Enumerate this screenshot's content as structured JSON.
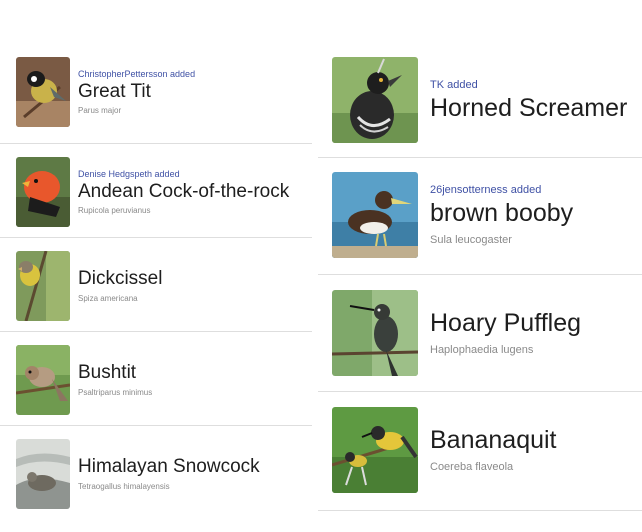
{
  "left_column": [
    {
      "added_by": "ChristopherPettersson added",
      "common_name": "Great Tit",
      "scientific_name": "Parus major",
      "thumb_icon": "great-tit-photo"
    },
    {
      "added_by": "Denise Hedgspeth added",
      "common_name": "Andean Cock-of-the-rock",
      "scientific_name": "Rupicola peruvianus",
      "thumb_icon": "cock-of-the-rock-photo"
    },
    {
      "added_by": "",
      "common_name": "Dickcissel",
      "scientific_name": "Spiza americana",
      "thumb_icon": "dickcissel-photo"
    },
    {
      "added_by": "",
      "common_name": "Bushtit",
      "scientific_name": "Psaltriparus minimus",
      "thumb_icon": "bushtit-photo"
    },
    {
      "added_by": "",
      "common_name": "Himalayan Snowcock",
      "scientific_name": "Tetraogallus himalayensis",
      "thumb_icon": "snowcock-photo"
    }
  ],
  "right_column": [
    {
      "added_by": "TK added",
      "common_name": "Horned Screamer",
      "scientific_name": "",
      "thumb_icon": "horned-screamer-photo"
    },
    {
      "added_by": "26jensotterness added",
      "common_name": "brown booby",
      "scientific_name": "Sula leucogaster",
      "thumb_icon": "brown-booby-photo"
    },
    {
      "added_by": "",
      "common_name": "Hoary Puffleg",
      "scientific_name": "Haplophaedia lugens",
      "thumb_icon": "hoary-puffleg-photo"
    },
    {
      "added_by": "",
      "common_name": "Bananaquit",
      "scientific_name": "Coereba flaveola",
      "thumb_icon": "bananaquit-photo"
    }
  ],
  "colors": {
    "added_text": "#3f51a5",
    "common_name_text": "#1e1e1e",
    "scientific_name_text": "#8a8a8a",
    "divider": "#dedede"
  }
}
